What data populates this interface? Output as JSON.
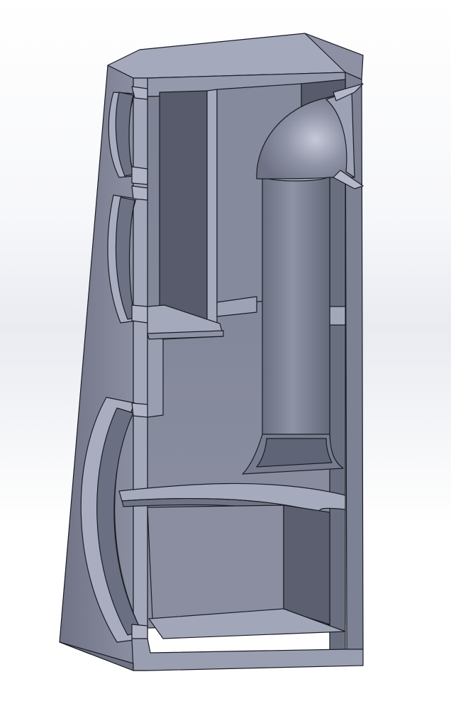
{
  "viewport": {
    "view": "section-view",
    "model": "speaker-enclosure-cutaway",
    "background_color": "#eef0f5"
  },
  "colors": {
    "outer_side": "#7f8395",
    "cut_face": "#9ea2b5",
    "cavity_wall": "#5c6070",
    "cavity_back": "#858a9c",
    "panel_top": "#a7abbe",
    "edge": "#1b1d24",
    "port_body": "#7a7f91",
    "port_highlight": "#b3b7c9"
  },
  "parts": [
    {
      "name": "cabinet-outer-shell"
    },
    {
      "name": "top-panel"
    },
    {
      "name": "tweeter-cutout"
    },
    {
      "name": "midrange-cutout"
    },
    {
      "name": "woofer-cutout"
    },
    {
      "name": "internal-shelf"
    },
    {
      "name": "bass-reflex-port"
    },
    {
      "name": "port-bend-elbow"
    },
    {
      "name": "curved-baffle-brace"
    },
    {
      "name": "bottom-panel"
    }
  ]
}
